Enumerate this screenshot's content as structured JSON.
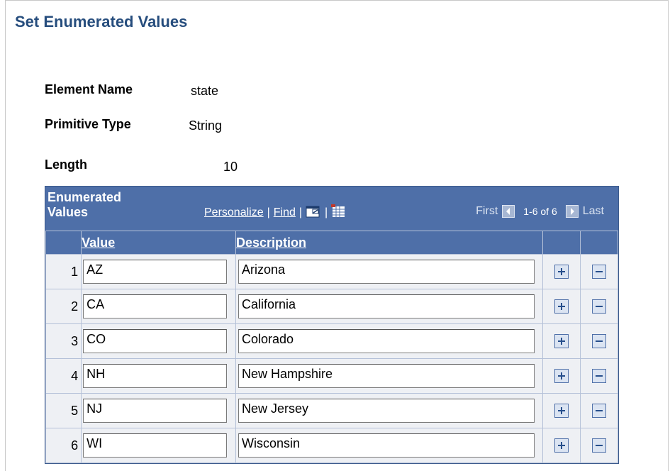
{
  "page": {
    "title": "Set Enumerated Values"
  },
  "fields": {
    "element_name": {
      "label": "Element Name",
      "value": "state"
    },
    "primitive_type": {
      "label": "Primitive Type",
      "value": "String"
    },
    "length": {
      "label": "Length",
      "value": "10"
    }
  },
  "grid": {
    "title_line1": "Enumerated",
    "title_line2": "Values",
    "personalize": "Personalize",
    "find": "Find",
    "separator": "|",
    "first": "First",
    "range": "1-6 of 6",
    "last": "Last",
    "columns": {
      "value": "Value",
      "description": "Description"
    },
    "rows": [
      {
        "num": "1",
        "value": "AZ",
        "description": "Arizona"
      },
      {
        "num": "2",
        "value": "CA",
        "description": "California"
      },
      {
        "num": "3",
        "value": "CO",
        "description": "Colorado"
      },
      {
        "num": "4",
        "value": "NH",
        "description": "New Hampshire"
      },
      {
        "num": "5",
        "value": "NJ",
        "description": "New Jersey"
      },
      {
        "num": "6",
        "value": "WI",
        "description": "Wisconsin"
      }
    ]
  },
  "icons": {
    "zoom": "view-all-icon",
    "download": "download-to-excel-icon",
    "prev": "arrow-left-icon",
    "next": "arrow-right-icon",
    "add": "plus-icon",
    "delete": "minus-icon"
  },
  "colors": {
    "title": "#264d7d",
    "grid_header": "#4e6fa8"
  }
}
